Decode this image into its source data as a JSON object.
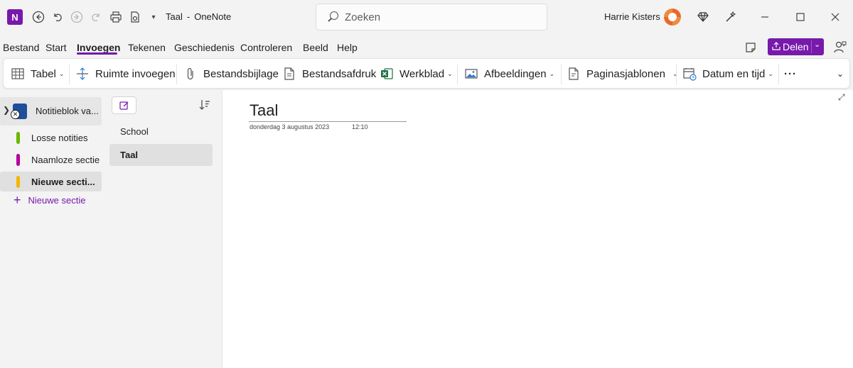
{
  "titlebar": {
    "app_logo": "N",
    "page_name": "Taal",
    "separator": "-",
    "app_name": "OneNote",
    "search_placeholder": "Zoeken",
    "user_name": "Harrie Kisters"
  },
  "menu": {
    "items": [
      "Bestand",
      "Start",
      "Invoegen",
      "Tekenen",
      "Geschiedenis",
      "Controleren",
      "Beeld",
      "Help"
    ],
    "active": "Invoegen",
    "share_label": "Delen"
  },
  "ribbon": {
    "table": "Tabel",
    "insert_space": "Ruimte invoegen",
    "file_attachment": "Bestandsbijlage",
    "file_printout": "Bestandsafdruk",
    "spreadsheet": "Werkblad",
    "images": "Afbeeldingen",
    "page_templates": "Paginasjablonen",
    "date_time": "Datum en tijd",
    "more": "···"
  },
  "notebook": {
    "name": "Notitieblok va...",
    "sections": [
      {
        "label": "Losse notities",
        "color": "#6bb700"
      },
      {
        "label": "Naamloze sectie",
        "color": "#b4009e"
      },
      {
        "label": "Nieuwe secti...",
        "color": "#f2b705",
        "active": true
      }
    ],
    "add_section": "Nieuwe sectie"
  },
  "pages": {
    "items": [
      {
        "label": "School"
      },
      {
        "label": "Taal",
        "active": true
      }
    ]
  },
  "canvas": {
    "title": "Taal",
    "date": "donderdag 3 augustus 2023",
    "time": "12:10"
  },
  "colors": {
    "accent": "#7719aa"
  }
}
